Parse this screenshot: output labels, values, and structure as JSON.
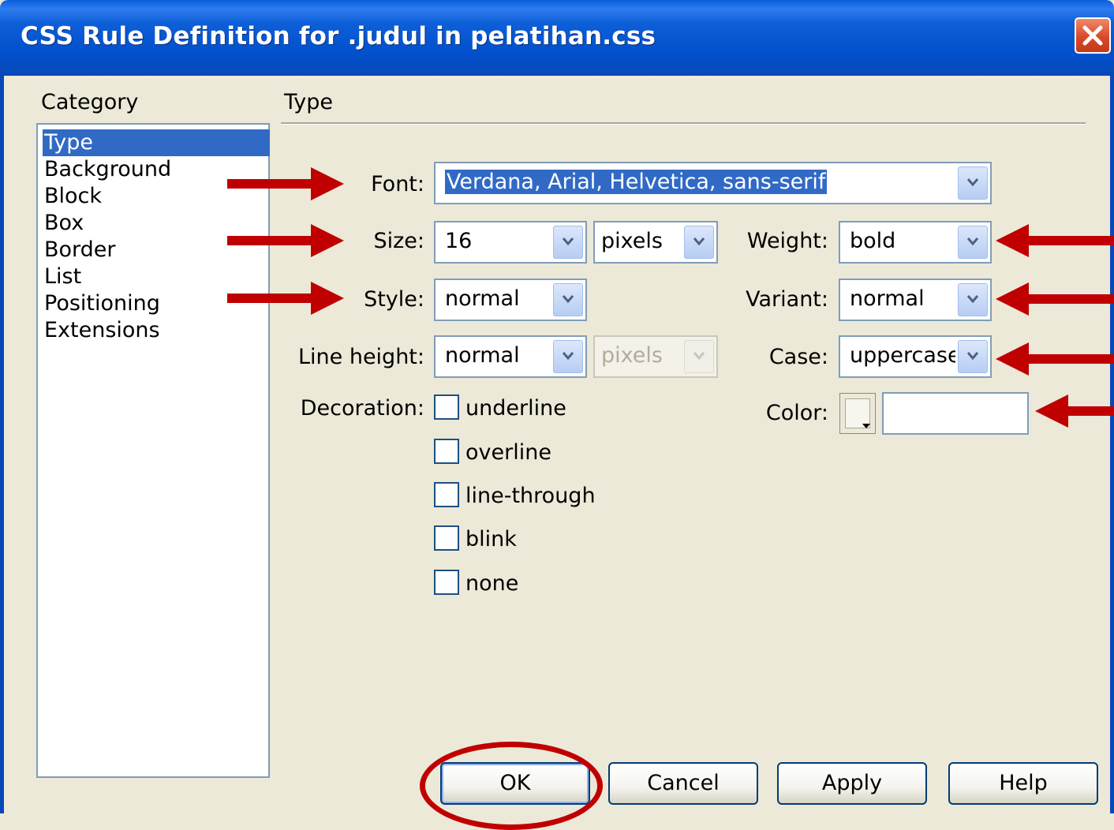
{
  "window": {
    "title": "CSS Rule Definition for .judul in pelatihan.css",
    "close_label": "×"
  },
  "category": {
    "label": "Category",
    "items": [
      {
        "label": "Type",
        "selected": true
      },
      {
        "label": "Background"
      },
      {
        "label": "Block"
      },
      {
        "label": "Box"
      },
      {
        "label": "Border"
      },
      {
        "label": "List"
      },
      {
        "label": "Positioning"
      },
      {
        "label": "Extensions"
      }
    ]
  },
  "panel": {
    "title": "Type"
  },
  "fields": {
    "font": {
      "label": "Font:",
      "value": "Verdana, Arial, Helvetica, sans-serif"
    },
    "size": {
      "label": "Size:",
      "value": "16",
      "unit": "pixels"
    },
    "style": {
      "label": "Style:",
      "value": "normal"
    },
    "line_height": {
      "label": "Line height:",
      "value": "normal",
      "unit": "pixels"
    },
    "decoration": {
      "label": "Decoration:",
      "options": [
        "underline",
        "overline",
        "line-through",
        "blink",
        "none"
      ]
    },
    "weight": {
      "label": "Weight:",
      "value": "bold"
    },
    "variant": {
      "label": "Variant:",
      "value": "normal"
    },
    "case": {
      "label": "Case:",
      "value": "uppercase"
    },
    "color": {
      "label": "Color:",
      "value": ""
    }
  },
  "buttons": {
    "ok": "OK",
    "cancel": "Cancel",
    "apply": "Apply",
    "help": "Help"
  },
  "annotation_color": "#c00000"
}
